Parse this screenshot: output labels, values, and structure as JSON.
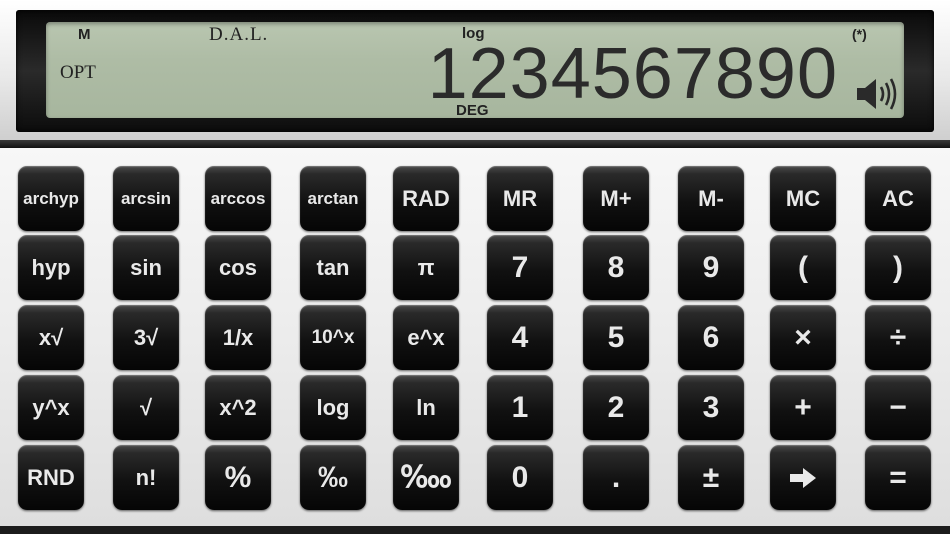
{
  "display": {
    "indicators": {
      "memory": "M",
      "dal": "D.A.L.",
      "log": "log",
      "option": "OPT",
      "angle_mode": "DEG",
      "asterisk": "(*)"
    },
    "value": "1234567890",
    "speaker_icon": "speaker-volume-icon"
  },
  "colors": {
    "lcd_background": "#adbba4",
    "lcd_text": "#2b2b2b",
    "key_background": "#111111",
    "key_text": "#e9e9e9",
    "panel_background": "#eeeeee"
  },
  "keys": {
    "archyp": "archyp",
    "arcsin": "arcsin",
    "arccos": "arccos",
    "arctan": "arctan",
    "rad": "RAD",
    "mr": "MR",
    "mplus": "M+",
    "mminus": "M-",
    "mc": "MC",
    "ac": "AC",
    "hyp": "hyp",
    "sin": "sin",
    "cos": "cos",
    "tan": "tan",
    "pi": "π",
    "seven": "7",
    "eight": "8",
    "nine": "9",
    "lparen": "(",
    "rparen": ")",
    "xroot": "x√",
    "cuberoot": "3√",
    "reciprocal": "1/x",
    "tenpow": "10^x",
    "epow": "e^x",
    "four": "4",
    "five": "5",
    "six": "6",
    "multiply": "×",
    "divide": "÷",
    "ypow": "y^x",
    "sqrt": "√",
    "square": "x^2",
    "log": "log",
    "ln": "ln",
    "one": "1",
    "two": "2",
    "three": "3",
    "plus": "+",
    "minus": "−",
    "rnd": "RND",
    "factorial": "n!",
    "percent": "%",
    "permille": "‰",
    "permyriad": "‱",
    "zero": "0",
    "decimal": ".",
    "plusminus": "±",
    "arrow_icon": "right-arrow-icon",
    "equals": "="
  }
}
